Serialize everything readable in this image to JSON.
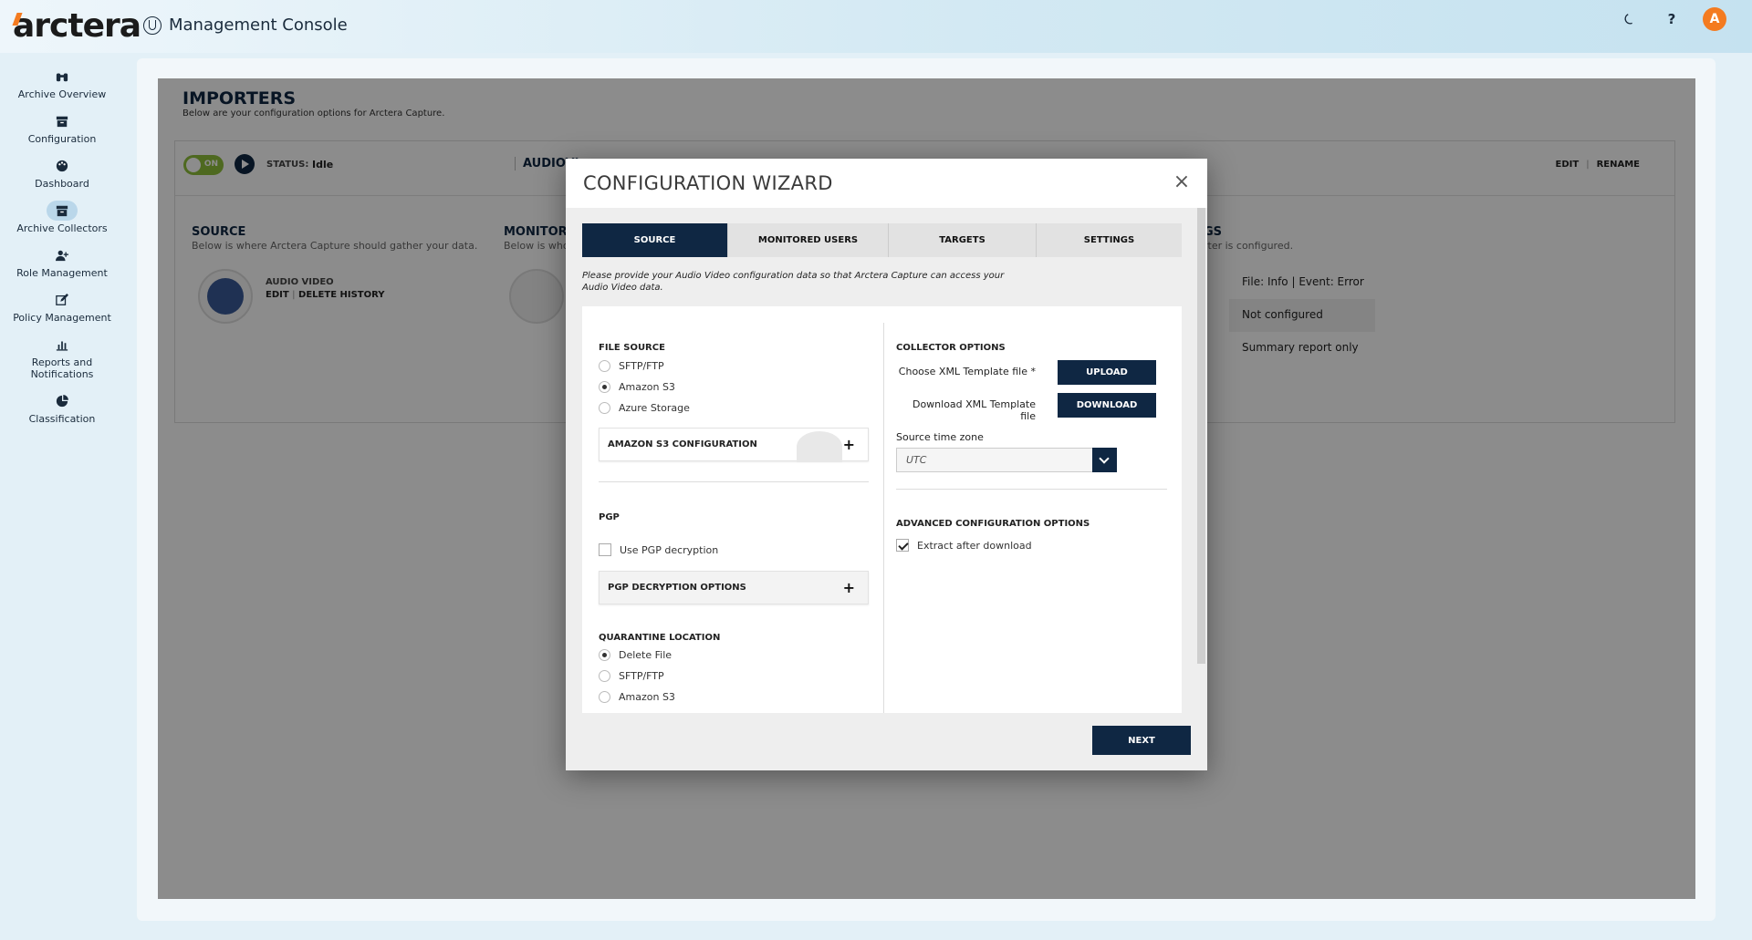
{
  "header": {
    "logo": "arctera",
    "app_title": "Management Console",
    "avatar_initial": "A"
  },
  "sidebar": {
    "items": [
      {
        "label": "Archive Overview",
        "icon": "binoculars-icon"
      },
      {
        "label": "Configuration",
        "icon": "archive-box-icon"
      },
      {
        "label": "Dashboard",
        "icon": "palette-icon"
      },
      {
        "label": "Archive Collectors",
        "icon": "archive-box-icon",
        "active": true
      },
      {
        "label": "Role Management",
        "icon": "user-plus-icon"
      },
      {
        "label": "Policy Management",
        "icon": "edit-icon"
      },
      {
        "label": "Reports and Notifications",
        "icon": "bar-chart-icon"
      },
      {
        "label": "Classification",
        "icon": "pie-chart-icon"
      }
    ]
  },
  "page": {
    "title": "IMPORTERS",
    "subtitle": "Below are your configuration options for Arctera Capture."
  },
  "importer_card": {
    "toggle_label": "ON",
    "status_label": "STATUS:",
    "status_value": "Idle",
    "name": "AUDIOVI",
    "edit": "EDIT",
    "rename": "RENAME",
    "source_title": "SOURCE",
    "source_desc": "Below is where Arctera Capture should gather your data.",
    "source_name": "AUDIO VIDEO",
    "source_edit": "EDIT",
    "source_delete": "DELETE HISTORY",
    "monitored_title": "MONITORE",
    "monitored_desc": "Below is whos",
    "settings_title": "GS",
    "settings_desc": "rter is configured.",
    "settings_rows": [
      "File: Info | Event: Error",
      "Not configured",
      "Summary report only"
    ]
  },
  "modal": {
    "title": "CONFIGURATION WIZARD",
    "tabs": [
      "SOURCE",
      "MONITORED USERS",
      "TARGETS",
      "SETTINGS"
    ],
    "intro": "Please provide your Audio Video configuration data so that Arctera Capture can access your Audio Video data.",
    "file_source": {
      "label": "FILE SOURCE",
      "options": [
        "SFTP/FTP",
        "Amazon S3",
        "Azure Storage"
      ],
      "selected": "Amazon S3"
    },
    "s3_config_label": "AMAZON S3 CONFIGURATION",
    "pgp": {
      "label": "PGP",
      "checkbox_label": "Use PGP decryption",
      "checked": false,
      "options_label": "PGP DECRYPTION OPTIONS"
    },
    "quarantine": {
      "label": "QUARANTINE LOCATION",
      "options": [
        "Delete File",
        "SFTP/FTP",
        "Amazon S3"
      ],
      "selected": "Delete File"
    },
    "collector": {
      "label": "COLLECTOR OPTIONS",
      "choose_label": "Choose XML Template file *",
      "upload": "UPLOAD",
      "download_label": "Download XML Template file",
      "download": "DOWNLOAD",
      "tz_label": "Source time zone",
      "tz_value": "UTC"
    },
    "advanced": {
      "label": "ADVANCED CONFIGURATION OPTIONS",
      "checkbox_label": "Extract after download",
      "checked": true
    },
    "next": "NEXT"
  },
  "colors": {
    "navy": "#0f2743",
    "accent_orange": "#f47b20",
    "toggle_green": "#8fbf3b"
  }
}
